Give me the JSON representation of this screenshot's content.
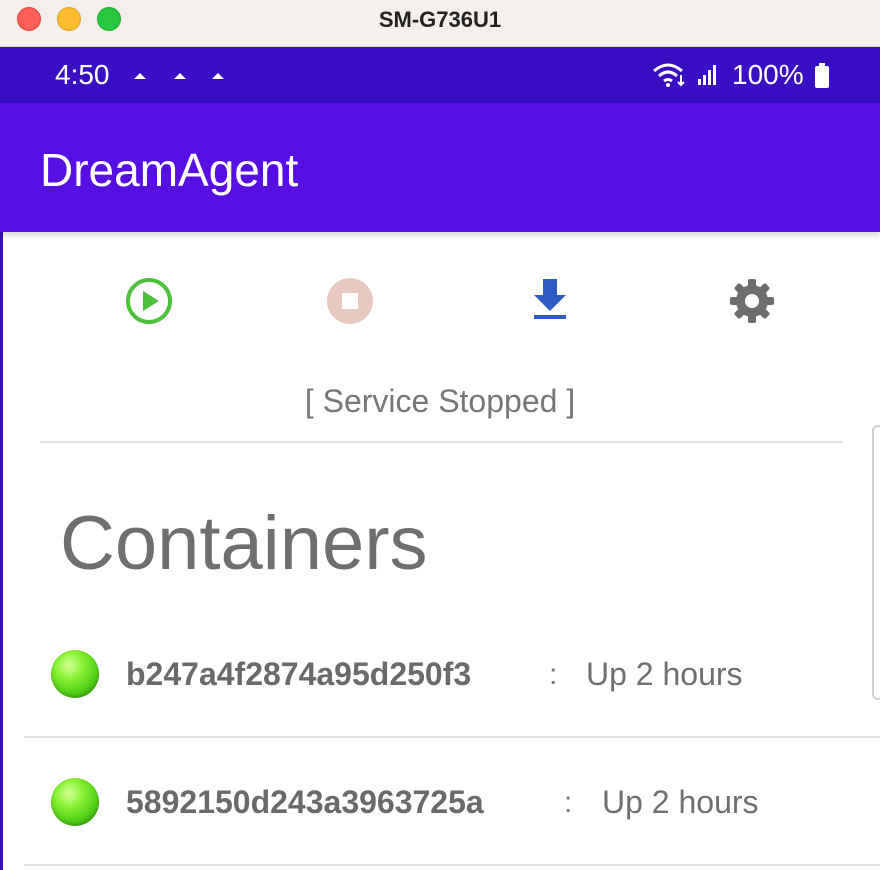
{
  "window": {
    "title": "SM-G736U1"
  },
  "statusbar": {
    "time": "4:50",
    "battery": "100%",
    "icons": [
      "notification-icon",
      "notification-icon",
      "notification-icon",
      "wifi-icon",
      "signal-icon",
      "battery-icon"
    ]
  },
  "app": {
    "title": "DreamAgent",
    "colors": {
      "statusbar": "#3a0fc4",
      "appbar": "#560ee3",
      "start": "#4cc23a",
      "stop": "#e8c7bf",
      "download": "#2e5bc4",
      "settings": "#6d6d6d"
    }
  },
  "toolbar": {
    "buttons": [
      {
        "icon": "play-circle-icon",
        "action": "start-service"
      },
      {
        "icon": "stop-circle-icon",
        "action": "stop-service"
      },
      {
        "icon": "download-icon",
        "action": "download"
      },
      {
        "icon": "gear-icon",
        "action": "settings"
      }
    ]
  },
  "service": {
    "status_text": "[ Service Stopped ]"
  },
  "containers": {
    "heading": "Containers",
    "items": [
      {
        "id": "b247a4f2874a95d250f3",
        "separator": ":",
        "status": "Up 2 hours",
        "state_icon": "green-ball-icon"
      },
      {
        "id": "5892150d243a3963725a",
        "separator": ":",
        "status": "Up 2 hours",
        "state_icon": "green-ball-icon"
      }
    ]
  }
}
